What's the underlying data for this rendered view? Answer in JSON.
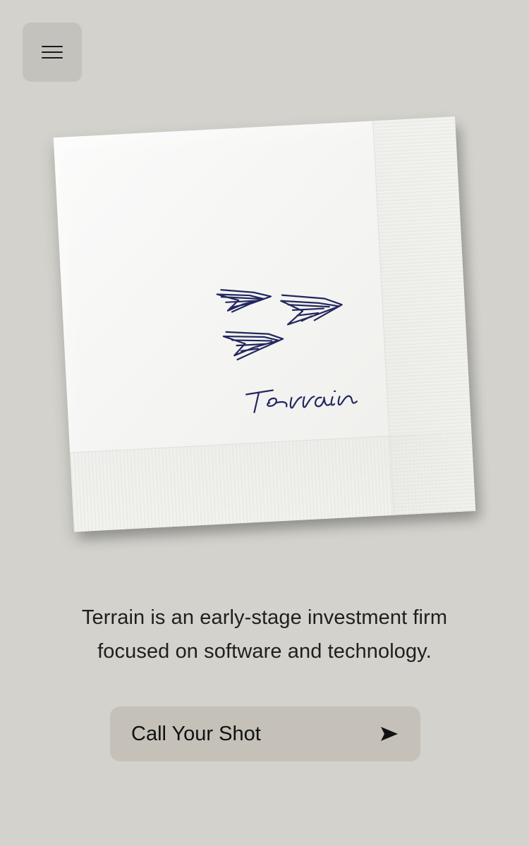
{
  "hero": {
    "tagline": "Terrain is an early-stage investment firm\nfocused on software and technology.",
    "napkin_logo_text": "Terrain"
  },
  "cta": {
    "label": "Call Your Shot"
  },
  "icons": {
    "menu": "menu-icon",
    "cta": "send-arrow-icon"
  },
  "colors": {
    "background": "#d3d2cc",
    "button_bg": "#c5c1b9",
    "menu_bg": "#c4c2bc",
    "text": "#1f1f1f",
    "ink": "#23275f"
  }
}
